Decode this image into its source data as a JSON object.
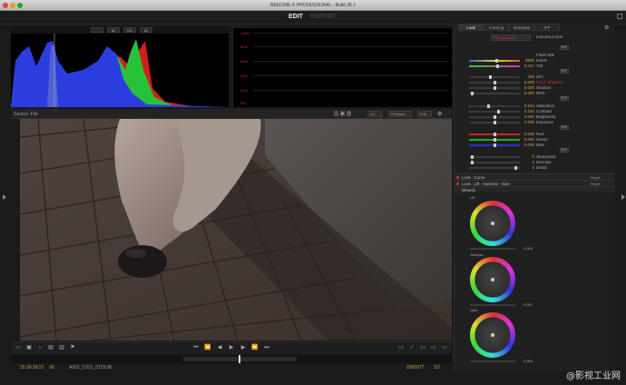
{
  "window": {
    "title": "REDCINE-X PROFESSIONAL - Build 35.1"
  },
  "modes": {
    "edit": "EDIT",
    "export": "EXPORT"
  },
  "histogram": {
    "buttons": [
      "",
      "ID",
      "ED",
      "ID"
    ]
  },
  "graph": {
    "labels": [
      "100%",
      "80%",
      "60%",
      "40%",
      "20%",
      "0%"
    ]
  },
  "viewer": {
    "title": "Source: File",
    "zoom": "1/2",
    "fit": "Fit Mode",
    "quality": "Full"
  },
  "status": {
    "timecode": "15:30:29:21",
    "fps": "00",
    "clip_name": "A002_C021_0125UB",
    "frame": "2000977",
    "speed": "1/2"
  },
  "panel": {
    "tabs": [
      "Look",
      "Framing",
      "Metadata",
      "IPP"
    ],
    "top": {
      "setting": "REDgamma3",
      "setting2": "",
      "curve_label": "Gamma Curve"
    },
    "rows": [
      {
        "label": "Flash WB",
        "value": ""
      },
      {
        "label": "Kelvin",
        "value": "5600"
      },
      {
        "label": "Tint",
        "value": "0.047"
      },
      {
        "label": "ISO",
        "value": "400"
      },
      {
        "label": "FLUT Shadow",
        "value": "0.000"
      },
      {
        "label": "Shadow",
        "value": "0.000"
      },
      {
        "label": "DRX",
        "value": "0.000"
      },
      {
        "label": "Saturation",
        "value": "0.844"
      },
      {
        "label": "Contrast",
        "value": "0.162"
      },
      {
        "label": "Brightness",
        "value": "0.000"
      },
      {
        "label": "Exposure",
        "value": "0.000"
      },
      {
        "label": "Red",
        "value": "0.000"
      },
      {
        "label": "Green",
        "value": "0.000"
      },
      {
        "label": "Blue",
        "value": "0.000"
      },
      {
        "label": "Sharpness",
        "value": "0"
      },
      {
        "label": "Denoise",
        "value": "0"
      },
      {
        "label": "Detail",
        "value": "0"
      }
    ],
    "sections": [
      {
        "title": "Look : Curve",
        "reset": "Reset"
      },
      {
        "title": "Look : Lift - Gamma - Gain",
        "reset": "Reset"
      },
      {
        "title": "Wheels",
        "reset": ""
      }
    ],
    "wheels": [
      {
        "label": "Lift",
        "value": "0.008"
      },
      {
        "label": "Gamma",
        "value": "0.007"
      },
      {
        "label": "Gain",
        "value": "0.000"
      }
    ],
    "mbtn": "M C"
  },
  "watermark": "@影视工业网"
}
